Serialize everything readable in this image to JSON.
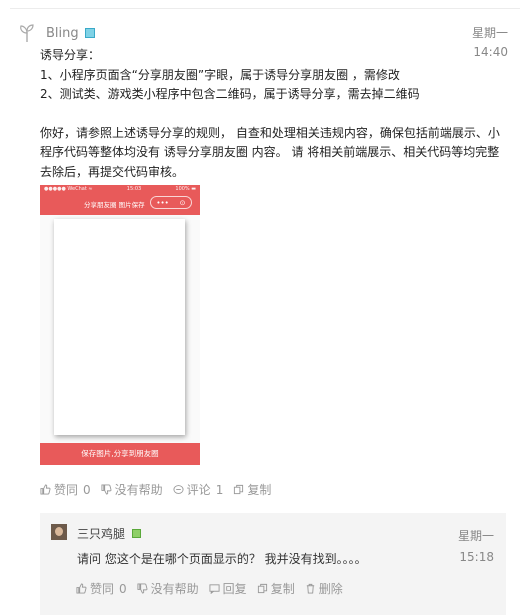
{
  "post": {
    "author": "Bling",
    "day": "星期一",
    "time": "14:40",
    "body": [
      "诱导分享：",
      "1、小程序页面含“分享朋友圈”字眼，属于诱导分享朋友圈 ，需修改",
      "2、测试类、游戏类小程序中包含二维码，属于诱导分享，需去掉二维码",
      "",
      "你好，请参照上述诱导分享的规则， 自查和处理相关违规内容，确保包括前端展示、小程序代码等整体均没有 诱导分享朋友圈 内容。 请 将相关前端展示、相关代码等均完整去除后，再提交代码审核。"
    ],
    "actions": {
      "like_label": "赞同",
      "like_count": "0",
      "unhelpful_label": "没有帮助",
      "comment_label": "评论",
      "comment_count": "1",
      "copy_label": "复制"
    }
  },
  "screenshot_mock": {
    "status_left": "●●●●● WeChat ≈",
    "status_center": "15:03",
    "status_right": "100% ▬",
    "nav_title": "分享朋友圈 图片保存",
    "capsule_dots": "•••",
    "capsule_close": "⊙",
    "save_button": "保存图片,分享到朋友圈"
  },
  "reply": {
    "author": "三只鸡腿",
    "day": "星期一",
    "time": "15:18",
    "text": "请问 您这个是在哪个页面显示的？ 我并没有找到。。。。",
    "actions": {
      "like_label": "赞同",
      "like_count": "0",
      "unhelpful_label": "没有帮助",
      "reply_label": "回复",
      "copy_label": "复制",
      "delete_label": "删除"
    }
  },
  "colors": {
    "accent_red": "#e85a5a",
    "badge_blue": "#7fd2e6",
    "badge_green": "#8ecf67"
  }
}
